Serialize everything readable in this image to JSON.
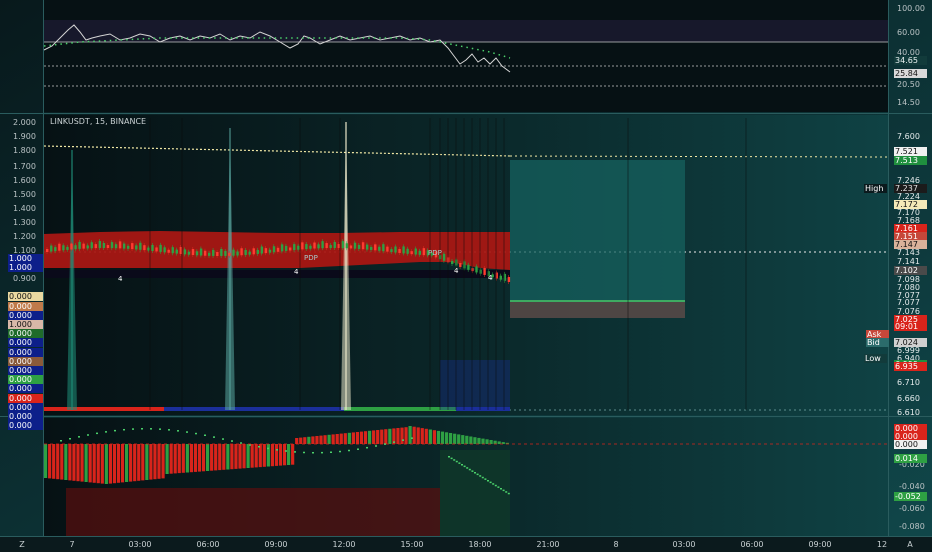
{
  "chart": {
    "symbol_title": "LINKUSDT, 15, BINANCE",
    "colors": {
      "bg_dark": "#061114",
      "bg_teal": "#0e3b3d",
      "bull": "#2ea043",
      "bear": "#d9241b",
      "band": "#a81713",
      "rsi_line": "#d5d5d5",
      "dots": "#4bd16b"
    },
    "rsi_scale": [
      "100.00",
      "60.00",
      "40.00",
      "20.50",
      "14.50"
    ],
    "rsi_badges": [
      {
        "text": "34.65",
        "bg": "#123b3b",
        "fg": "#e8f0f0"
      },
      {
        "text": "25.84",
        "bg": "#d9d9d9",
        "fg": "#111111"
      }
    ],
    "price_scale": [
      "7.600",
      "7.246",
      "7.224",
      "7.170",
      "7.168",
      "7.143",
      "7.141",
      "7.098",
      "7.080",
      "7.077",
      "7.077",
      "7.076",
      "6.999",
      "6.940",
      "6.710",
      "6.660",
      "6.610"
    ],
    "price_badges": [
      {
        "text": "7.521",
        "bg": "#f0f0f0",
        "fg": "#111111"
      },
      {
        "text": "7.513",
        "bg": "#1f8f3e",
        "fg": "#ffffff"
      },
      {
        "text": "7.237",
        "bg": "#1b1b1b",
        "fg": "#e0e0e0"
      },
      {
        "text": "7.172",
        "bg": "#f4e9b8",
        "fg": "#111111"
      },
      {
        "text": "7.161",
        "bg": "#d9241b",
        "fg": "#ffffff"
      },
      {
        "text": "7.151",
        "bg": "#c6473a",
        "fg": "#ffffff"
      },
      {
        "text": "7.147",
        "bg": "#d9b29a",
        "fg": "#111111"
      },
      {
        "text": "7.102",
        "bg": "#4a4a4a",
        "fg": "#ffffff"
      },
      {
        "text": "7.025",
        "bg": "#d9241b",
        "fg": "#ffffff"
      },
      {
        "text": "09:01",
        "bg": "#d9241b",
        "fg": "#ffffff"
      },
      {
        "text": "7.024",
        "bg": "#d0d0d0",
        "fg": "#111111"
      },
      {
        "text": "6.999",
        "bg": "#1f8f3e",
        "fg": "#ffffff"
      },
      {
        "text": "6.935",
        "bg": "#d9241b",
        "fg": "#ffffff"
      }
    ],
    "side_tags": [
      {
        "text": "High",
        "bg": "#0b1a1d",
        "fg": "#ffffff"
      },
      {
        "text": "Ask",
        "bg": "#c6473a",
        "fg": "#ffffff"
      },
      {
        "text": "Bid",
        "bg": "#2b6b6b",
        "fg": "#ffffff"
      },
      {
        "text": "Low",
        "bg": "#123b3b",
        "fg": "#ffffff"
      }
    ],
    "left_scale": [
      "2.000",
      "1.900",
      "1.800",
      "1.700",
      "1.600",
      "1.500",
      "1.400",
      "1.300",
      "1.200",
      "1.100",
      "0.900"
    ],
    "left_badges": [
      {
        "text": "1.000",
        "bg": "#0d1f8a",
        "fg": "#ffffff"
      },
      {
        "text": "1.000",
        "bg": "#0d1f8a",
        "fg": "#ffffff"
      },
      {
        "text": "0.000",
        "bg": "#e9d8a0",
        "fg": "#111111"
      },
      {
        "text": "0.000",
        "bg": "#c07a4a",
        "fg": "#ffffff"
      },
      {
        "text": "0.000",
        "bg": "#0d1f8a",
        "fg": "#ffffff"
      },
      {
        "text": "1.000",
        "bg": "#d8b8a8",
        "fg": "#111111"
      },
      {
        "text": "0.000",
        "bg": "#1f6b2a",
        "fg": "#ffffff"
      },
      {
        "text": "0.000",
        "bg": "#0d1f8a",
        "fg": "#ffffff"
      },
      {
        "text": "0.000",
        "bg": "#0d1f8a",
        "fg": "#ffffff"
      },
      {
        "text": "0.000",
        "bg": "#8a5a3a",
        "fg": "#ffffff"
      },
      {
        "text": "0.000",
        "bg": "#0d1f8a",
        "fg": "#ffffff"
      },
      {
        "text": "0.000",
        "bg": "#2ea043",
        "fg": "#ffffff"
      },
      {
        "text": "0.000",
        "bg": "#0d1f8a",
        "fg": "#ffffff"
      },
      {
        "text": "0.000",
        "bg": "#d9241b",
        "fg": "#ffffff"
      },
      {
        "text": "0.000",
        "bg": "#0d1f8a",
        "fg": "#ffffff"
      },
      {
        "text": "0.000",
        "bg": "#0d1f8a",
        "fg": "#ffffff"
      },
      {
        "text": "0.000",
        "bg": "#0d1f8a",
        "fg": "#ffffff"
      }
    ],
    "bottom_scale": [
      "-0.020",
      "-0.040",
      "-0.060",
      "-0.080"
    ],
    "bottom_badges": [
      {
        "text": "0.000",
        "bg": "#d9241b",
        "fg": "#ffffff"
      },
      {
        "text": "0.000",
        "bg": "#d9241b",
        "fg": "#ffffff"
      },
      {
        "text": "0.000",
        "bg": "#f0f0f0",
        "fg": "#111111"
      },
      {
        "text": "0.014",
        "bg": "#2ea043",
        "fg": "#ffffff"
      },
      {
        "text": "-0.052",
        "bg": "#2ea043",
        "fg": "#ffffff"
      }
    ],
    "chart_markers": [
      "4",
      "4",
      "4",
      "4",
      "PDP",
      "PDP"
    ],
    "time_axis": [
      "7",
      "03:00",
      "06:00",
      "09:00",
      "12:00",
      "15:00",
      "18:00",
      "21:00",
      "8",
      "03:00",
      "06:00",
      "09:00",
      "12"
    ],
    "corner_left": "Z",
    "corner_right": "A"
  }
}
